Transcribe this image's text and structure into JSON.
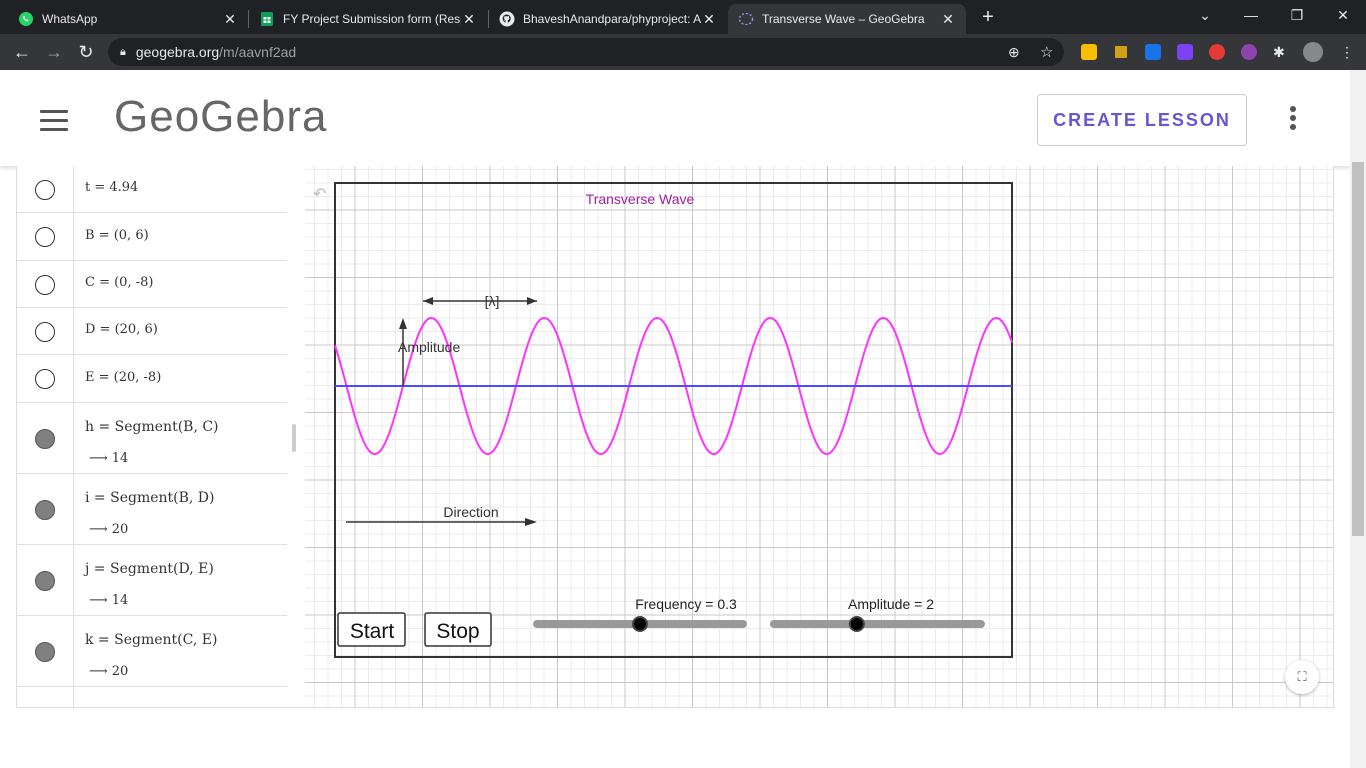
{
  "browser": {
    "tabs": [
      {
        "title": "WhatsApp",
        "active": false,
        "icon": "whatsapp-icon"
      },
      {
        "title": "FY Project Submission form (Resp",
        "active": false,
        "icon": "sheets-icon"
      },
      {
        "title": "BhaveshAnandpara/phyproject: A",
        "active": false,
        "icon": "github-icon"
      },
      {
        "title": "Transverse Wave – GeoGebra",
        "active": true,
        "icon": "geogebra-icon"
      }
    ],
    "url_host": "geogebra.org",
    "url_path": "/m/aavnf2ad",
    "window_controls": {
      "minimize": "—",
      "restore": "❐",
      "close": "✕"
    }
  },
  "header": {
    "logo": "GeoGebra",
    "create_lesson": "CREATE LESSON"
  },
  "algebra": {
    "rows": [
      {
        "text": "t = 4.94",
        "filled": false
      },
      {
        "text": "B = (0, 6)",
        "filled": false
      },
      {
        "text": "C = (0, -8)",
        "filled": false
      },
      {
        "text": "D = (20, 6)",
        "filled": false
      },
      {
        "text": "E = (20, -8)",
        "filled": false
      },
      {
        "text": "h = Segment(B, C)",
        "value": "⟶ 14",
        "filled": true
      },
      {
        "text": "i = Segment(B, D)",
        "value": "⟶ 20",
        "filled": true
      },
      {
        "text": "j = Segment(D, E)",
        "value": "⟶ 14",
        "filled": true
      },
      {
        "text": "k = Segment(C, E)",
        "value": "⟶ 20",
        "filled": true
      }
    ]
  },
  "graphics": {
    "title": "Transverse Wave",
    "lambda_label": "[λ]",
    "amplitude_label": "Amplitude",
    "direction_label": "Direction",
    "start_button": "Start",
    "stop_button": "Stop",
    "frequency_slider": {
      "label": "Frequency = 0.3",
      "value": 0.3,
      "fraction": 0.5
    },
    "amplitude_slider": {
      "label": "Amplitude = 2",
      "value": 2,
      "fraction": 0.4
    },
    "colors": {
      "wave": "#ff33ff",
      "axis": "#4b4bff",
      "title": "#a020a0",
      "frame": "#333333"
    }
  }
}
